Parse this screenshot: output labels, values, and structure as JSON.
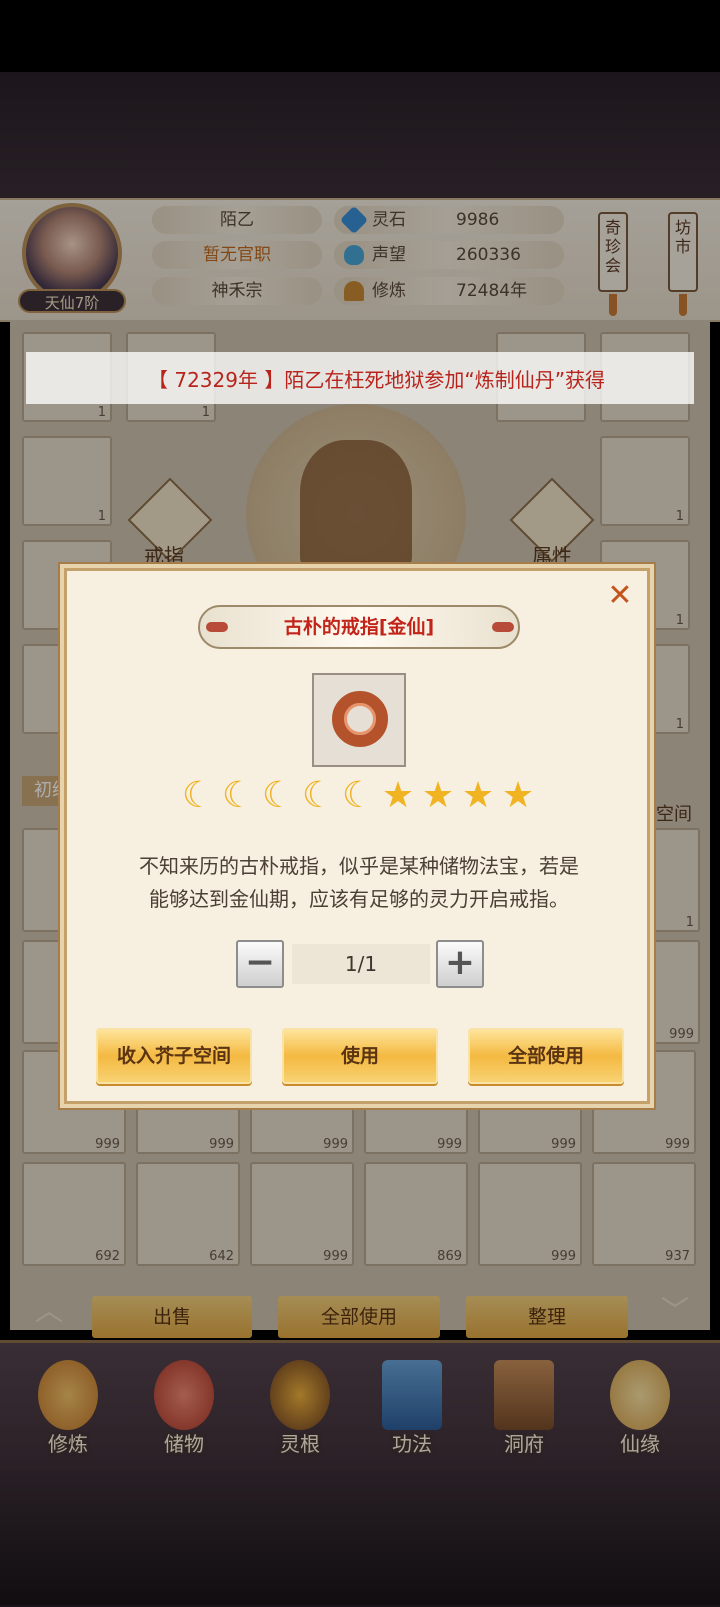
{
  "player": {
    "name": "陌乙",
    "title": "暂无官职",
    "sect": "神禾宗",
    "rank": "天仙7阶"
  },
  "stats": [
    {
      "label": "灵石",
      "value": "9986",
      "icon": "spirit-stone-icon",
      "color": "#3a8fd8"
    },
    {
      "label": "声望",
      "value": "260336",
      "icon": "reputation-icon",
      "color": "#4aa6d6"
    },
    {
      "label": "修炼",
      "value": "72484年",
      "icon": "meditation-icon",
      "color": "#c78a34"
    }
  ],
  "shops": {
    "treasure": "奇珍会",
    "market": "坊市"
  },
  "ticker": {
    "text": "【 72329年 】陌乙在枉死地狱参加“炼制仙丹”获得"
  },
  "equip": {
    "ring_label": "戒指",
    "attr_label": "属性",
    "space_label": "芥子空间",
    "tier_label": "初级"
  },
  "grid_counts": {
    "left_col": [
      "1",
      "1",
      "",
      ""
    ],
    "right_col": [
      "1",
      "1",
      "1",
      "1"
    ],
    "row_a": [
      "",
      "999",
      "999",
      "999",
      "999",
      "999",
      "999"
    ],
    "row_b": [
      "692",
      "642",
      "999",
      "869",
      "999",
      "937"
    ],
    "purple_count": "1"
  },
  "modal": {
    "title": "古朴的戒指[金仙]",
    "rating": {
      "moons": 5,
      "stars": 4
    },
    "description_1": "不知来历的古朴戒指，似乎是某种储物法宝，若是",
    "description_2": "能够达到金仙期，应该有足够的灵力开启戒指。",
    "quantity": "1/1",
    "minus": "−",
    "plus": "+",
    "close": "✕",
    "buttons": {
      "store": "收入芥子空间",
      "use": "使用",
      "use_all": "全部使用"
    }
  },
  "bottom_actions": {
    "sell": "出售",
    "use_all": "全部使用",
    "sort": "整理"
  },
  "nav": [
    {
      "label": "修炼",
      "icon": "cultivate-icon"
    },
    {
      "label": "储物",
      "icon": "storage-bag-icon"
    },
    {
      "label": "灵根",
      "icon": "spirit-root-icon"
    },
    {
      "label": "功法",
      "icon": "technique-book-icon"
    },
    {
      "label": "洞府",
      "icon": "cave-dwelling-icon"
    },
    {
      "label": "仙缘",
      "icon": "immortal-fate-icon"
    }
  ]
}
